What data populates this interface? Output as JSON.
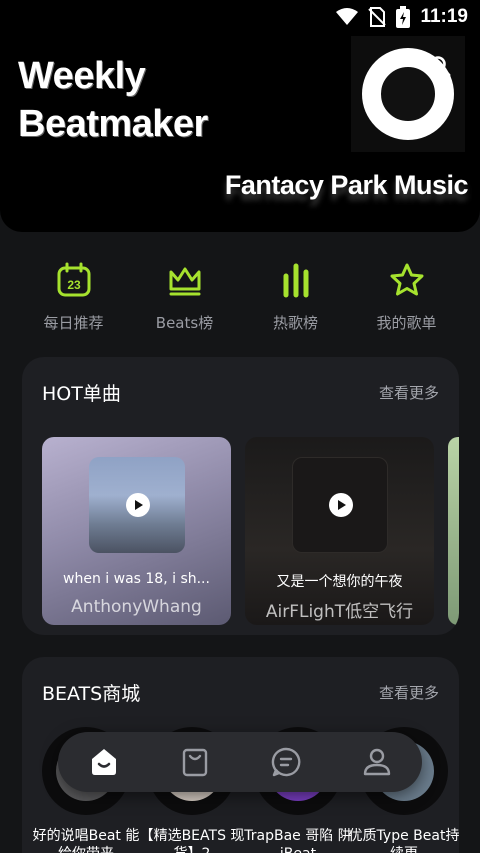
{
  "status": {
    "time": "11:19"
  },
  "banner": {
    "title": "Weekly\nBeatmaker",
    "brand": "Fantacy Park Music",
    "logo_text": "FANTACY PARK MUSIC"
  },
  "quick_nav": [
    {
      "label": "每日推荐",
      "icon": "calendar-icon",
      "badge": "23"
    },
    {
      "label": "Beats榜",
      "icon": "crown-icon"
    },
    {
      "label": "热歌榜",
      "icon": "bars-icon"
    },
    {
      "label": "我的歌单",
      "icon": "star-icon"
    }
  ],
  "hot": {
    "title": "HOT单曲",
    "more": "查看更多",
    "songs": [
      {
        "name": "when i was 18, i sh...",
        "artist": "AnthonyWhang"
      },
      {
        "name": "又是一个想你的午夜",
        "artist": "AirFLighT低空飞行"
      }
    ]
  },
  "beats": {
    "title": "BEATS商城",
    "more": "查看更多",
    "items": [
      {
        "label": "好的说唱Beat 能给你带来"
      },
      {
        "label": "【精选BEATS 现货】2"
      },
      {
        "label": "TrapBae 哥陷 阱 iBeat"
      },
      {
        "label": "优质Type Beat持续更"
      }
    ]
  },
  "colors": {
    "accent": "#a6e22e",
    "background": "#141517",
    "card": "#1e1f23"
  },
  "bottom_nav": [
    "home-icon",
    "bag-icon",
    "chat-icon",
    "profile-icon"
  ]
}
